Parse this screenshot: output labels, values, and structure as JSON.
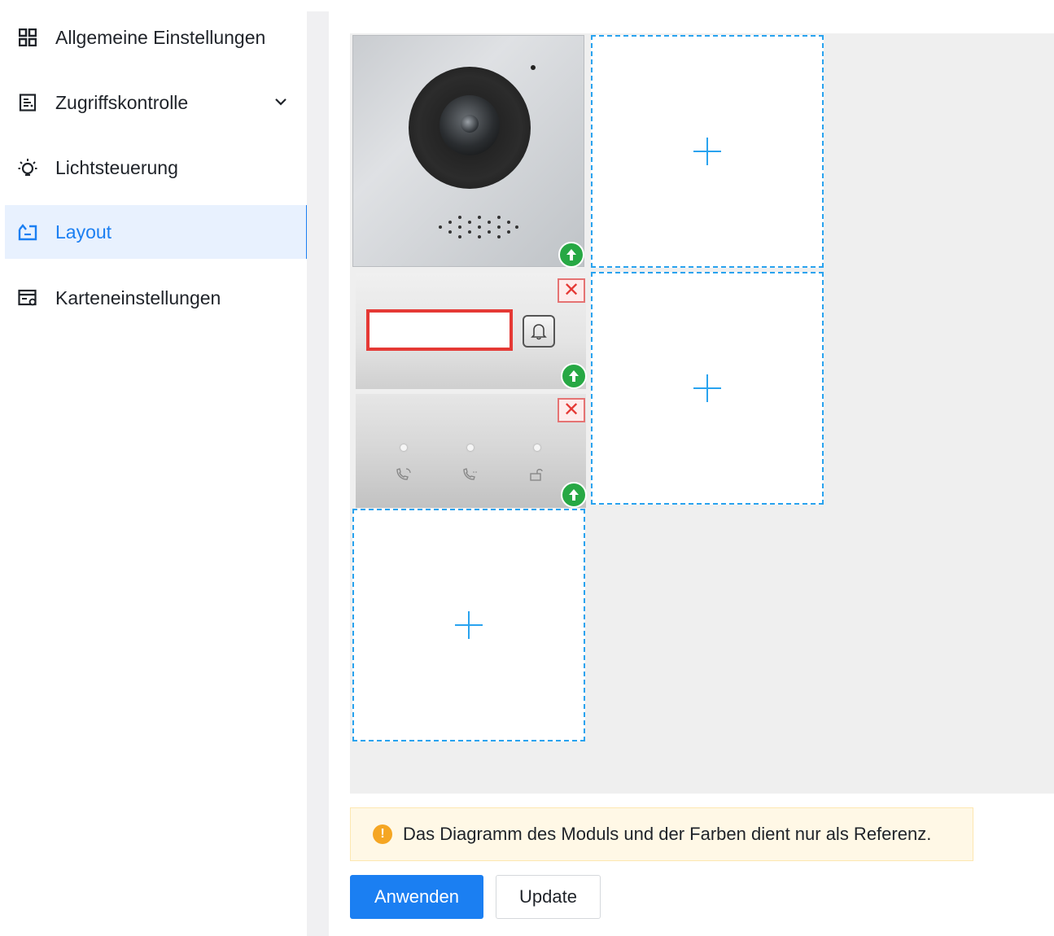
{
  "sidebar": {
    "items": [
      {
        "label": "Allgemeine Einstellungen",
        "icon": "grid-icon"
      },
      {
        "label": "Zugriffskontrolle",
        "icon": "door-panel-icon",
        "expandable": true
      },
      {
        "label": "Lichtsteuerung",
        "icon": "light-bulb-icon"
      },
      {
        "label": "Layout",
        "icon": "layout-icon",
        "active": true
      },
      {
        "label": "Karteneinstellungen",
        "icon": "card-settings-icon"
      }
    ]
  },
  "layout": {
    "modules": [
      {
        "type": "camera-module",
        "has_upload": true
      },
      {
        "type": "button-module",
        "name_value": "",
        "has_remove": true,
        "has_upload": true
      },
      {
        "type": "status-indicator-module",
        "has_remove": true,
        "has_upload": true
      }
    ],
    "empty_slots": 3
  },
  "notice": {
    "text": "Das Diagramm des Moduls und der Farben dient nur als Referenz."
  },
  "actions": {
    "apply_label": "Anwenden",
    "update_label": "Update"
  },
  "colors": {
    "accent": "#1b7ff2",
    "active_bg": "#e8f1fe",
    "slot_border": "#29a3ef",
    "upload_green": "#27a844",
    "remove_red": "#e53935",
    "notice_bg": "#fff8e6"
  }
}
